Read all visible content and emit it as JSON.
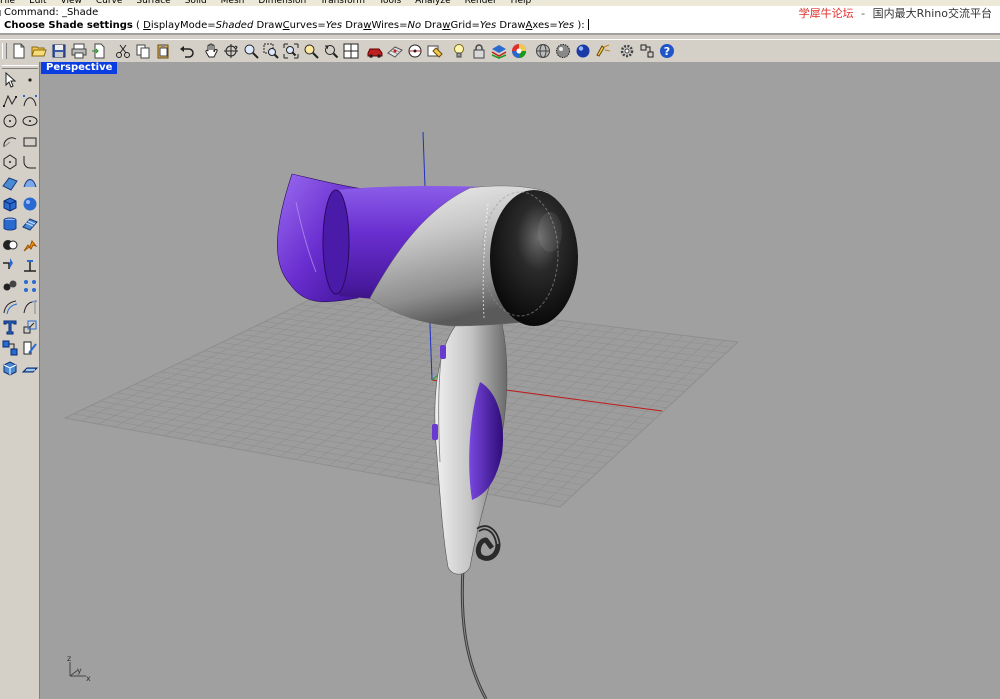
{
  "menu": {
    "items": [
      "File",
      "Edit",
      "View",
      "Curve",
      "Surface",
      "Solid",
      "Mesh",
      "Dimension",
      "Transform",
      "Tools",
      "Analyze",
      "Render",
      "Help"
    ]
  },
  "command": {
    "history_label": "Command:",
    "history_value": "_Shade",
    "prompt_title": "Choose Shade settings",
    "options_open": "(",
    "options_close": "):",
    "options": [
      {
        "pre": "",
        "key": "D",
        "post": "isplayMode",
        "value": "Shaded"
      },
      {
        "pre": "Draw",
        "key": "C",
        "post": "urves",
        "value": "Yes"
      },
      {
        "pre": "Dra",
        "key": "w",
        "post": "Wires",
        "value": "No"
      },
      {
        "pre": "Dra",
        "key": "w",
        "post": "Grid",
        "value": "Yes"
      },
      {
        "pre": "Draw",
        "key": "A",
        "post": "xes",
        "value": "Yes"
      }
    ]
  },
  "watermark": {
    "site": "学犀牛论坛",
    "separator": "-",
    "tagline": "国内最大Rhino交流平台"
  },
  "toolbar": {
    "icons": [
      "new-icon",
      "open-icon",
      "save-icon",
      "print-icon",
      "import-icon",
      "cut-icon",
      "copy-icon",
      "paste-icon",
      "undo-icon",
      "pan-hand-icon",
      "rotate-view-icon",
      "zoom-icon",
      "zoom-window-icon",
      "zoom-extents-icon",
      "zoom-selected-icon",
      "undo-view-icon",
      "four-viewports-icon",
      "car-icon",
      "grid-snap-icon",
      "osnap-icon",
      "object-properties-icon",
      "light-bulb-icon",
      "lock-icon",
      "layer-icon",
      "color-wheel-icon",
      "display-shaded-icon",
      "rendered-icon",
      "render-sphere-icon",
      "light-icon",
      "options-gear-icon",
      "tools-icon",
      "help-icon"
    ]
  },
  "sidebar": {
    "rows": [
      [
        "select-arrow-icon",
        "point-icon"
      ],
      [
        "polyline-icon",
        "curve-control-points-icon"
      ],
      [
        "circle-icon",
        "ellipse-icon"
      ],
      [
        "arc-icon",
        "rectangle-icon"
      ],
      [
        "polygon-icon",
        "fillet-curves-icon"
      ],
      [
        "surface-corners-icon",
        "surface-loft-icon"
      ],
      [
        "box-icon",
        "sphere-icon"
      ],
      [
        "cylinder-icon",
        "mesh-plane-icon"
      ],
      [
        "boolean-icon",
        "explode-icon"
      ],
      [
        "split-icon",
        "trim-icon"
      ],
      [
        "group-icon",
        "array-icon"
      ],
      [
        "offset-icon",
        "extend-icon"
      ],
      [
        "text-icon",
        "scale-icon"
      ],
      [
        "dimension-icon",
        "transform-icon"
      ],
      [
        "cube-view-icon",
        "ground-plane-icon"
      ]
    ]
  },
  "viewport": {
    "label": "Perspective",
    "background": "#a0a0a0",
    "grid_color": "#8f8f8f",
    "x_axis_color": "#c01818",
    "y_axis_color": "#1e9e1e",
    "z_axis_color": "#2030c0",
    "accent_color": "#5a1ec0",
    "shell_color": "#c9c9c9",
    "axes_widget": {
      "z": "z",
      "y": "y",
      "x": "x"
    }
  }
}
